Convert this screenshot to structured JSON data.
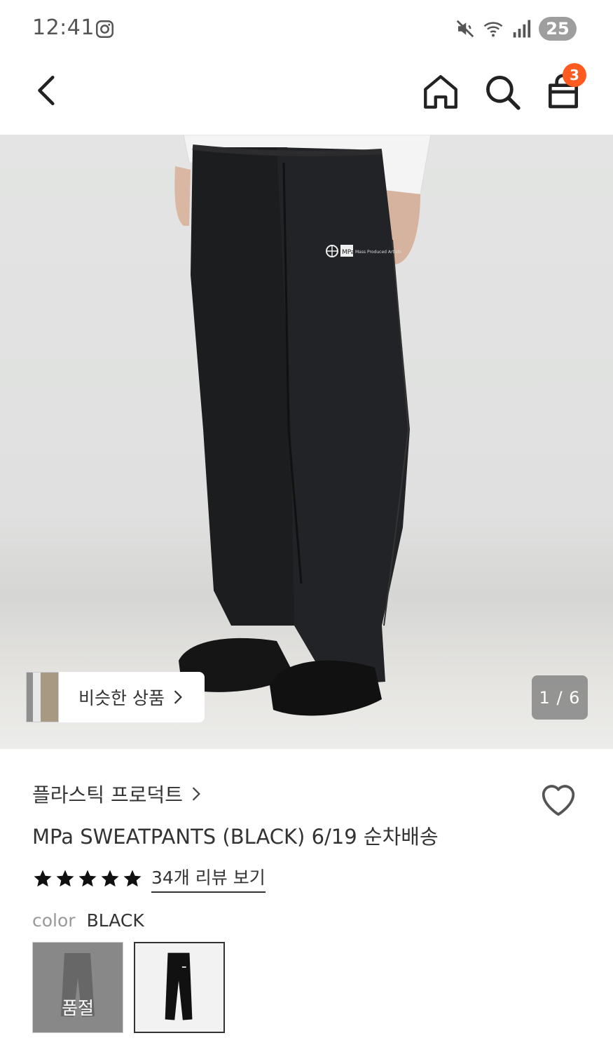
{
  "status_bar": {
    "time": "12:41",
    "battery": "25",
    "icons": [
      "instagram-icon",
      "mute-icon",
      "wifi-icon",
      "signal-icon"
    ]
  },
  "nav": {
    "icons": [
      "back-icon",
      "home-icon",
      "search-icon",
      "cart-icon"
    ],
    "cart_count": "3",
    "badge_color": "#ff5a1f"
  },
  "hero": {
    "similar_label": "비슷한 상품",
    "page_indicator": "1 / 6",
    "current_page": 1,
    "total_pages": 6,
    "print_brand": "MPa",
    "print_text": "Mass Produced Artists"
  },
  "product": {
    "brand": "플라스틱 프로덕트",
    "title": "MPa SWEATPANTS (BLACK) 6/19 순차배송",
    "rating_stars": 5,
    "review_link": "34개 리뷰 보기",
    "option_label": "color",
    "option_value": "BLACK",
    "swatches": [
      {
        "label": "품절",
        "selected": false
      },
      {
        "label": "",
        "selected": true
      }
    ]
  }
}
